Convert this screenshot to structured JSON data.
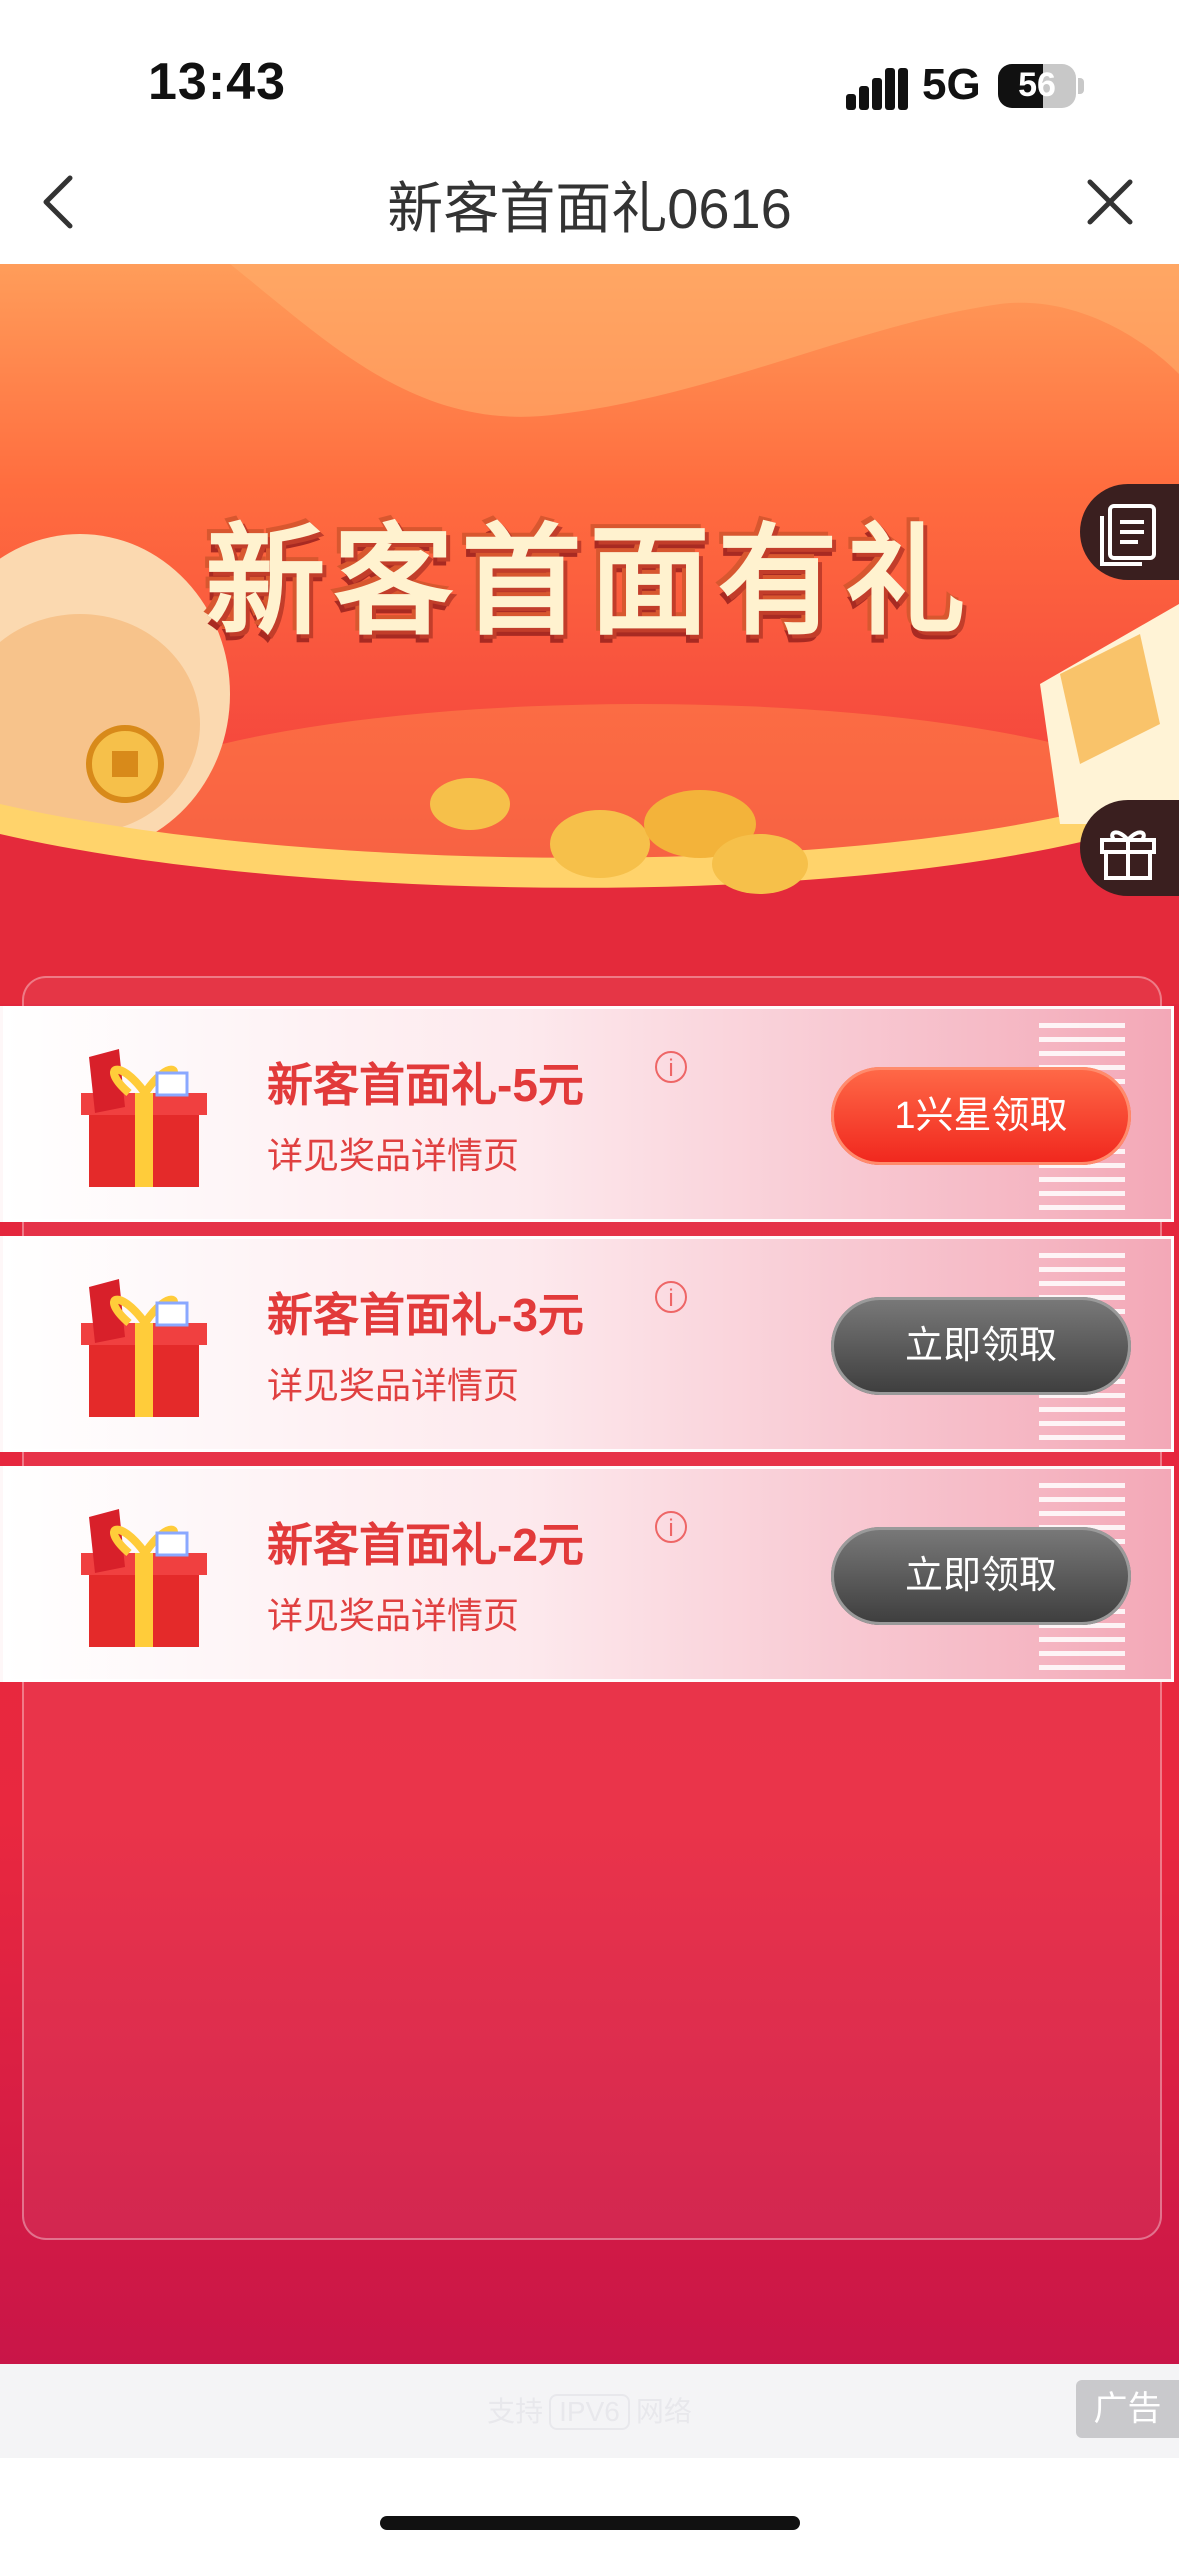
{
  "status_bar": {
    "time": "13:43",
    "network": "5G",
    "battery": "56"
  },
  "nav": {
    "title": "新客首面礼0616",
    "back_icon": "chevron-left-icon",
    "close_icon": "close-icon"
  },
  "banner": {
    "title": "新客首面有礼"
  },
  "side_buttons": [
    {
      "icon": "notes-icon"
    },
    {
      "icon": "gift-icon"
    }
  ],
  "rewards": [
    {
      "name": "新客首面礼-5元",
      "desc": "详见奖品详情页",
      "button": "1兴星领取",
      "button_style": "red"
    },
    {
      "name": "新客首面礼-3元",
      "desc": "详见奖品详情页",
      "button": "立即领取",
      "button_style": "gray"
    },
    {
      "name": "新客首面礼-2元",
      "desc": "详见奖品详情页",
      "button": "立即领取",
      "button_style": "gray"
    }
  ],
  "footer": {
    "network_label_left": "支持",
    "network_badge": "IPV6",
    "network_label_right": "网络",
    "ad_label": "广告"
  },
  "colors": {
    "accent_red": "#e9283f",
    "claim_red": "#f0261d",
    "claim_gray": "#3d3d3d"
  }
}
